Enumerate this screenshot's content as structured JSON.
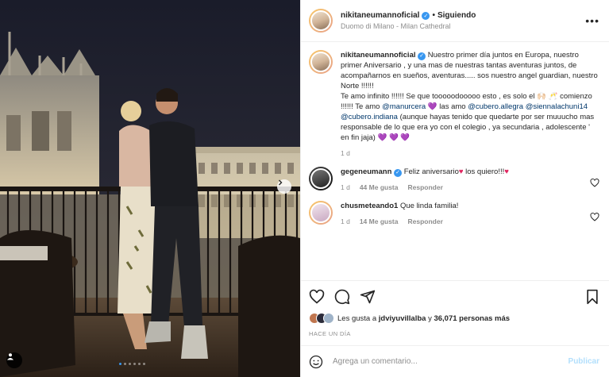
{
  "post": {
    "author": "nikitaneumannoficial",
    "follow_status": "Siguiendo",
    "separator": "•",
    "location": "Duomo di Milano - Milan Cathedral",
    "more_icon": "more-horizontal-icon"
  },
  "caption": {
    "username": "nikitaneumannoficial",
    "text1": "Nuestro primer día juntos en Europa, nuestro primer Aniversario , y una mas de nuestras tantas aventuras juntos, de acompañarnos en sueños, aventuras..... sos nuestro angel guardian, nuestro Norte !!!!!!",
    "text2": "Te amo infinito !!!!!! Se que tooooodooooo esto , es solo el 🙌🏻 🥂 comienzo !!!!!! Te amo",
    "mention1": "@manurcera",
    "heart1": "💜",
    "text3": "las amo",
    "mention2": "@cubero.allegra",
    "mention3": "@siennalachuni14",
    "mention4": "@cubero.indiana",
    "text4": "(aunque hayas tenido que quedarte por ser muuucho mas responsable de lo que era yo con el colegio , ya secundaria , adolescente ' en fin jaja)",
    "hearts_end": "💜 💜 💜",
    "time": "1 d"
  },
  "comments": [
    {
      "username": "gegeneumann",
      "text": "Feliz aniversario",
      "heart": "♥",
      "text_b": "los quiero!!!",
      "heart_b": "♥",
      "time": "1 d",
      "likes": "44 Me gusta",
      "reply": "Responder"
    },
    {
      "username": "chusmeteando1",
      "text": "Que linda familia!",
      "time": "1 d",
      "likes": "14 Me gusta",
      "reply": "Responder"
    }
  ],
  "actions": {
    "like_icon": "heart-icon",
    "comment_icon": "comment-icon",
    "share_icon": "share-icon",
    "save_icon": "bookmark-icon"
  },
  "likes": {
    "prefix": "Les gusta a",
    "user": "jdviyuvillalba",
    "mid": "y",
    "count": "36,071 personas más"
  },
  "posted_ago": "HACE UN DÍA",
  "add_comment": {
    "placeholder": "Agrega un comentario...",
    "emoji_icon": "smiley-icon",
    "publish_label": "Publicar"
  },
  "carousel": {
    "slides": 6,
    "active": 0
  },
  "colors": {
    "link": "#00376b",
    "verified": "#3897f0",
    "muted": "#8e8e8e",
    "publish_disabled": "#b2dffc"
  }
}
